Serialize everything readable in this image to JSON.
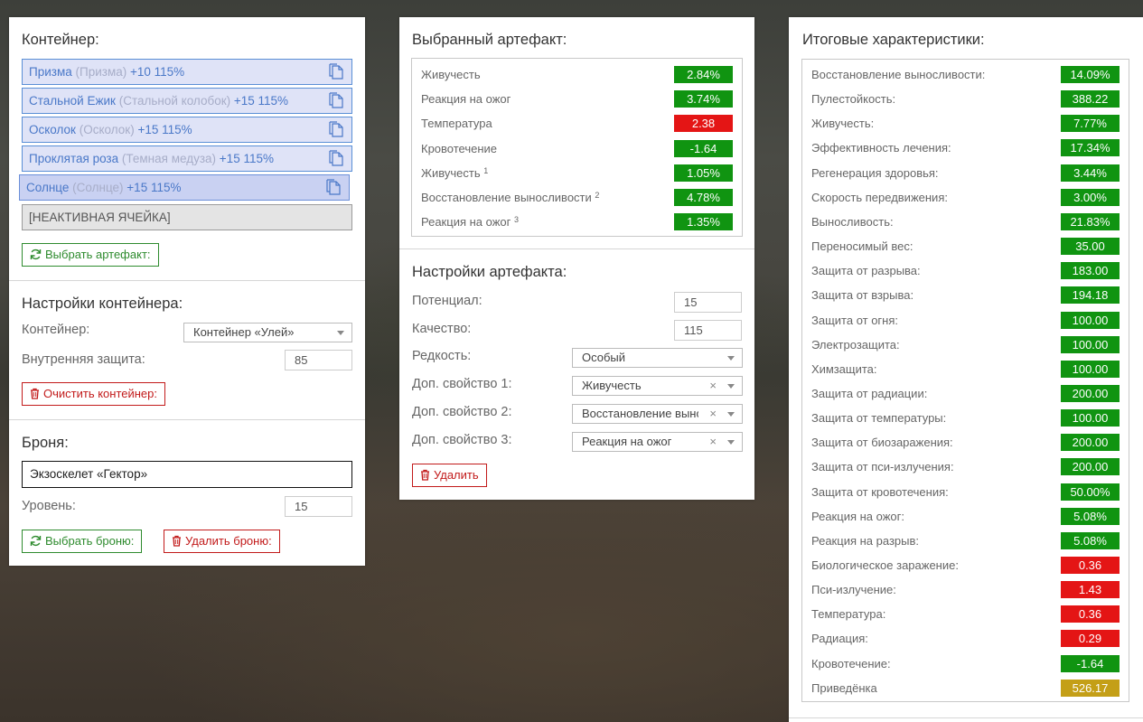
{
  "left_panel": {
    "container_title": "Контейнер:",
    "slots": [
      {
        "name": "Призма",
        "orig": "(Призма)",
        "value": "+10 115%"
      },
      {
        "name": "Стальной Ежик",
        "orig": "(Стальной колобок)",
        "value": "+15 115%"
      },
      {
        "name": "Осколок",
        "orig": "(Осколок)",
        "value": "+15 115%"
      },
      {
        "name": "Проклятая роза",
        "orig": "(Темная медуза)",
        "value": "+15 115%"
      },
      {
        "name": "Солнце",
        "orig": "(Солнце)",
        "value": "+15 115%"
      }
    ],
    "inactive_slot": "[НЕАКТИВНАЯ ЯЧЕЙКА]",
    "choose_artifact_button": "Выбрать артефакт:",
    "container_settings_title": "Настройки контейнера:",
    "container_label": "Контейнер:",
    "container_value": "Контейнер «Улей»",
    "inner_protection_label": "Внутренняя защита:",
    "inner_protection_value": "85",
    "clear_container_button": "Очистить контейнер:",
    "armor_title": "Броня:",
    "armor_value": "Экзоскелет «Гектор»",
    "level_label": "Уровень:",
    "level_value": "15",
    "choose_armor_button": "Выбрать броню:",
    "delete_armor_button": "Удалить броню:"
  },
  "mid_panel": {
    "selected_title": "Выбранный артефакт:",
    "stats": [
      {
        "label": "Живучесть",
        "sup": "",
        "value": "2.84%",
        "color": "green"
      },
      {
        "label": "Реакция на ожог",
        "sup": "",
        "value": "3.74%",
        "color": "green"
      },
      {
        "label": "Температура",
        "sup": "",
        "value": "2.38",
        "color": "red"
      },
      {
        "label": "Кровотечение",
        "sup": "",
        "value": "-1.64",
        "color": "green"
      },
      {
        "label": "Живучесть",
        "sup": "1",
        "value": "1.05%",
        "color": "green"
      },
      {
        "label": "Восстановление выносливости",
        "sup": "2",
        "value": "4.78%",
        "color": "green"
      },
      {
        "label": "Реакция на ожог",
        "sup": "3",
        "value": "1.35%",
        "color": "green"
      }
    ],
    "settings_title": "Настройки артефакта:",
    "potential_label": "Потенциал:",
    "potential_value": "15",
    "quality_label": "Качество:",
    "quality_value": "115",
    "rarity_label": "Редкость:",
    "rarity_value": "Особый",
    "prop1_label": "Доп. свойство 1:",
    "prop1_value": "Живучесть",
    "prop2_label": "Доп. свойство 2:",
    "prop2_value": "Восстановление выносливости",
    "prop3_label": "Доп. свойство 3:",
    "prop3_value": "Реакция на ожог",
    "delete_button": "Удалить"
  },
  "right_panel": {
    "title": "Итоговые характеристики:",
    "stats": [
      {
        "label": "Восстановление выносливости:",
        "value": "14.09%",
        "color": "green"
      },
      {
        "label": "Пулестойкость:",
        "value": "388.22",
        "color": "green"
      },
      {
        "label": "Живучесть:",
        "value": "7.77%",
        "color": "green"
      },
      {
        "label": "Эффективность лечения:",
        "value": "17.34%",
        "color": "green"
      },
      {
        "label": "Регенерация здоровья:",
        "value": "3.44%",
        "color": "green"
      },
      {
        "label": "Скорость передвижения:",
        "value": "3.00%",
        "color": "green"
      },
      {
        "label": "Выносливость:",
        "value": "21.83%",
        "color": "green"
      },
      {
        "label": "Переносимый вес:",
        "value": "35.00",
        "color": "green"
      },
      {
        "label": "Защита от разрыва:",
        "value": "183.00",
        "color": "green"
      },
      {
        "label": "Защита от взрыва:",
        "value": "194.18",
        "color": "green"
      },
      {
        "label": "Защита от огня:",
        "value": "100.00",
        "color": "green"
      },
      {
        "label": "Электрозащита:",
        "value": "100.00",
        "color": "green"
      },
      {
        "label": "Химзащита:",
        "value": "100.00",
        "color": "green"
      },
      {
        "label": "Защита от радиации:",
        "value": "200.00",
        "color": "green"
      },
      {
        "label": "Защита от температуры:",
        "value": "100.00",
        "color": "green"
      },
      {
        "label": "Защита от биозаражения:",
        "value": "200.00",
        "color": "green"
      },
      {
        "label": "Защита от пси-излучения:",
        "value": "200.00",
        "color": "green"
      },
      {
        "label": "Защита от кровотечения:",
        "value": "50.00%",
        "color": "green"
      },
      {
        "label": "Реакция на ожог:",
        "value": "5.08%",
        "color": "green"
      },
      {
        "label": "Реакция на разрыв:",
        "value": "5.08%",
        "color": "green"
      },
      {
        "label": "Биологическое заражение:",
        "value": "0.36",
        "color": "red"
      },
      {
        "label": "Пси-излучение:",
        "value": "1.43",
        "color": "red"
      },
      {
        "label": "Температура:",
        "value": "0.36",
        "color": "red"
      },
      {
        "label": "Радиация:",
        "value": "0.29",
        "color": "red"
      },
      {
        "label": "Кровотечение:",
        "value": "-1.64",
        "color": "green"
      },
      {
        "label": "Приведёнка",
        "value": "526.17",
        "color": "gold"
      }
    ]
  },
  "colors": {
    "green": "#109411",
    "red": "#e41515",
    "gold": "#c49f17",
    "slot_bg": "#dfe3f7",
    "slot_border": "#5a8fd6"
  },
  "icons": {
    "copy": "copy-icon",
    "refresh": "refresh-icon",
    "trash": "trash-icon",
    "dropdown": "chevron-down-icon",
    "clear": "clear-icon"
  }
}
